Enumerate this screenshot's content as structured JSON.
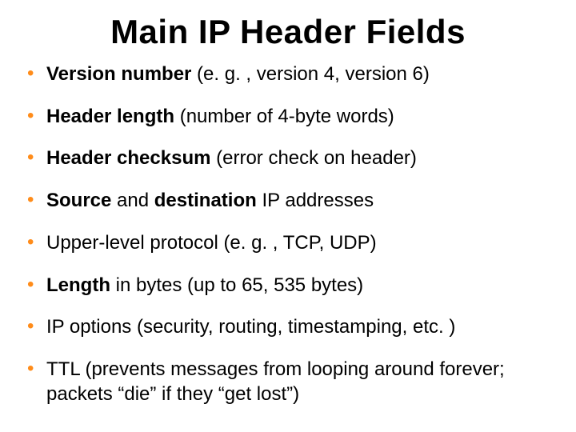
{
  "title": "Main IP Header Fields",
  "items": [
    {
      "em": "Version number",
      "rest": " (e. g. , version 4, version 6)"
    },
    {
      "em": "Header length",
      "rest": " (number of 4-byte words)"
    },
    {
      "em": "Header checksum",
      "rest": " (error check on header)"
    },
    {
      "em": "Source",
      "mid": " and ",
      "em2": "destination",
      "rest": " IP addresses"
    },
    {
      "plain": "Upper-level protocol (e. g. , TCP, UDP)"
    },
    {
      "em": "Length",
      "rest": " in bytes (up to 65, 535 bytes)"
    },
    {
      "plain": "IP options (security, routing, timestamping, etc. )"
    },
    {
      "plain": "TTL (prevents messages from looping around forever;  packets “die” if they “get lost”)"
    }
  ]
}
